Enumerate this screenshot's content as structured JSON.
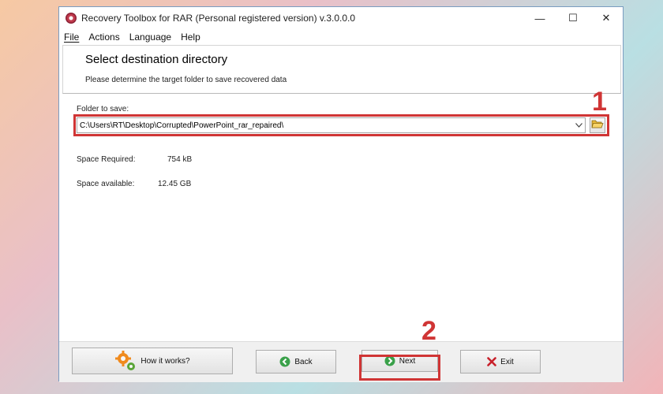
{
  "window": {
    "title": "Recovery Toolbox for RAR (Personal registered version) v.3.0.0.0",
    "controls": {
      "minimize": "—",
      "maximize": "☐",
      "close": "✕"
    }
  },
  "menu": [
    {
      "label": "File"
    },
    {
      "label": "Actions"
    },
    {
      "label": "Language"
    },
    {
      "label": "Help"
    }
  ],
  "header": {
    "title": "Select destination directory",
    "subtitle": "Please determine the target folder to save recovered data"
  },
  "folder": {
    "label": "Folder to save:",
    "value": "C:\\Users\\RT\\Desktop\\Corrupted\\PowerPoint_rar_repaired\\"
  },
  "space": {
    "required_label": "Space Required:",
    "required_value": "754 kB",
    "available_label": "Space available:",
    "available_value": "12.45 GB"
  },
  "buttons": {
    "how": "How it works?",
    "back": "Back",
    "next": "Next",
    "exit": "Exit"
  },
  "annotations": {
    "step1": "1",
    "step2": "2"
  },
  "colors": {
    "highlight": "#d03535",
    "back_icon": "#3aa14a",
    "next_icon": "#3aa14a",
    "exit_icon": "#c8202a",
    "gear": "#f08a1d"
  }
}
